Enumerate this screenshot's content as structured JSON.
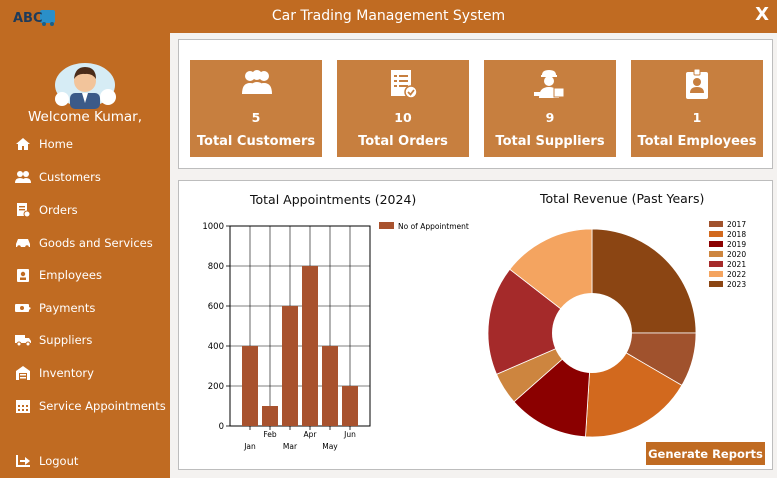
{
  "app": {
    "title": "Car Trading Management System",
    "logo_text": "ABC",
    "close_label": "X"
  },
  "sidebar": {
    "welcome": "Welcome  Kumar,",
    "items": [
      {
        "label": "Home",
        "icon": "home-icon"
      },
      {
        "label": "Customers",
        "icon": "customers-icon"
      },
      {
        "label": "Orders",
        "icon": "orders-icon"
      },
      {
        "label": "Goods and Services",
        "icon": "car-icon"
      },
      {
        "label": "Employees",
        "icon": "employees-icon"
      },
      {
        "label": "Payments",
        "icon": "payments-icon"
      },
      {
        "label": "Suppliers",
        "icon": "truck-icon"
      },
      {
        "label": "Inventory",
        "icon": "inventory-icon"
      },
      {
        "label": "Service Appointments",
        "icon": "calendar-icon"
      }
    ],
    "logout": {
      "label": "Logout",
      "icon": "logout-icon"
    }
  },
  "cards": [
    {
      "value": "5",
      "label": "Total Customers",
      "icon": "users-icon"
    },
    {
      "value": "10",
      "label": "Total Orders",
      "icon": "order-list-icon"
    },
    {
      "value": "9",
      "label": "Total Suppliers",
      "icon": "supplier-icon"
    },
    {
      "value": "1",
      "label": "Total Employees",
      "icon": "id-badge-icon"
    }
  ],
  "colors": {
    "accent": "#c06b22",
    "card": "#c77f3f",
    "bar": "#a8522e"
  },
  "chart_data": [
    {
      "type": "bar",
      "title": "Total Appointments (2024)",
      "categories": [
        "Jan",
        "Feb",
        "Mar",
        "Apr",
        "May",
        "Jun"
      ],
      "series": [
        {
          "name": "No of Appointment",
          "values": [
            400,
            100,
            600,
            800,
            400,
            200
          ]
        }
      ],
      "ylim": [
        0,
        1000
      ],
      "yticks": [
        "0",
        "200",
        "400",
        "600",
        "800",
        "1000"
      ],
      "grid": true,
      "legend_position": "top-right"
    },
    {
      "type": "pie",
      "title": "Total Revenue (Past Years)",
      "labels": [
        "2017",
        "2018",
        "2019",
        "2020",
        "2021",
        "2022",
        "2023"
      ],
      "colors": [
        "#a0522d",
        "#d2691e",
        "#8b0000",
        "#cd853f",
        "#a52a2a",
        "#f4a460",
        "#8b4513"
      ],
      "legend_colors": [
        "#a0522d",
        "#d2691e",
        "#8b0000",
        "#cd853f",
        "#a52a2a",
        "#f4a460",
        "#8b4513"
      ],
      "slices": [
        {
          "color": "#8b4513",
          "value": 25
        },
        {
          "color": "#a0522d",
          "value": 8.4
        },
        {
          "color": "#d2691e",
          "value": 17.6
        },
        {
          "color": "#8b0000",
          "value": 12.5
        },
        {
          "color": "#cd853f",
          "value": 5
        },
        {
          "color": "#a52a2a",
          "value": 17
        },
        {
          "color": "#f4a460",
          "value": 14.5
        }
      ],
      "donut": true,
      "legend_position": "top-right"
    }
  ],
  "button": {
    "generate": "Generate Reports"
  }
}
